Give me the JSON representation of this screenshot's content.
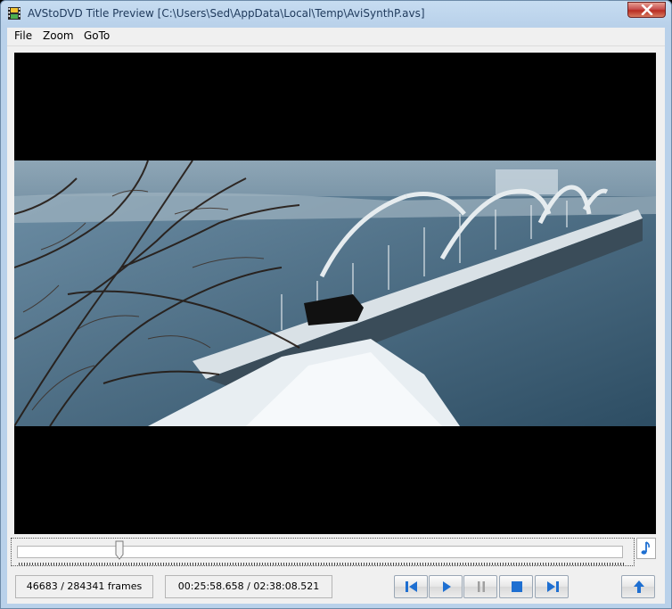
{
  "window": {
    "title": "AVStoDVD Title Preview [C:\\Users\\Sed\\AppData\\Local\\Temp\\AviSynthP.avs]"
  },
  "menu": {
    "items": [
      "File",
      "Zoom",
      "GoTo"
    ]
  },
  "status": {
    "frames": "46683 / 284341  frames",
    "time": "00:25:58.658 / 02:38:08.521"
  },
  "seek": {
    "position_fraction": 0.1642
  },
  "icons": {
    "app": "film-icon",
    "close": "close-icon",
    "audio": "music-note-icon",
    "prev": "step-back-icon",
    "play": "play-icon",
    "pause": "pause-icon",
    "stop": "stop-icon",
    "next": "step-forward-icon",
    "eject": "eject-icon"
  },
  "colors": {
    "control_blue": "#1e6fd1",
    "disabled": "#a0a0a0"
  }
}
